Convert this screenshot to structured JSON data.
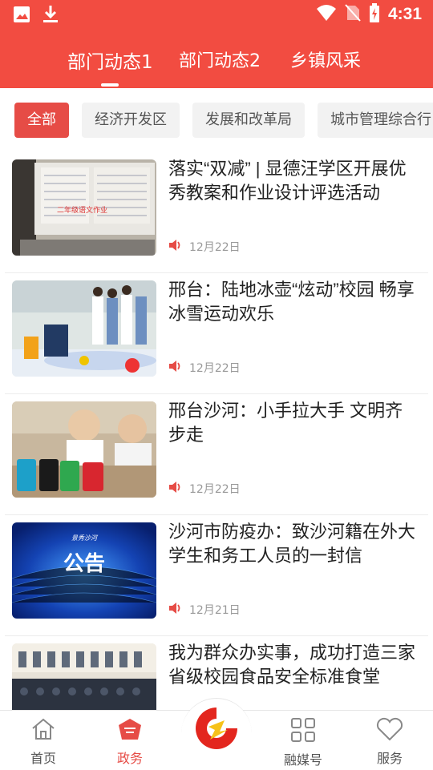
{
  "status_bar": {
    "time": "4:31",
    "left_icons": [
      "image-icon",
      "download-icon"
    ],
    "right_icons": [
      "wifi-icon",
      "no-sim-icon",
      "battery-charging-icon"
    ]
  },
  "top_tabs": [
    {
      "label": "部门动态1",
      "active": true
    },
    {
      "label": "部门动态2",
      "active": false
    },
    {
      "label": "乡镇风采",
      "active": false
    }
  ],
  "filter_chips": [
    {
      "label": "全部",
      "active": true
    },
    {
      "label": "经济开发区",
      "active": false
    },
    {
      "label": "发展和改革局",
      "active": false
    },
    {
      "label": "城市管理综合行",
      "active": false
    }
  ],
  "articles": [
    {
      "title": "落实“双减” | 显德汪学区开展优秀教案和作业设计评选活动",
      "date": "12月22日",
      "thumb_caption": "二年级语文作业"
    },
    {
      "title": "邢台：陆地冰壶“炫动”校园 畅享冰雪运动欢乐",
      "date": "12月22日"
    },
    {
      "title": "邢台沙河：小手拉大手 文明齐步走",
      "date": "12月22日"
    },
    {
      "title": "沙河市防疫办：致沙河籍在外大学生和务工人员的一封信",
      "date": "12月21日",
      "thumb_caption": "公告",
      "thumb_top": "景秀沙河"
    },
    {
      "title": "我为群众办实事，成功打造三家省级校园食品安全标准食堂",
      "date": ""
    }
  ],
  "bottom_nav": [
    {
      "label": "首页",
      "icon": "home-icon",
      "active": false
    },
    {
      "label": "政务",
      "icon": "government-icon",
      "active": true
    },
    {
      "label": "",
      "icon": "app-logo-icon",
      "active": false
    },
    {
      "label": "融媒号",
      "icon": "grid-icon",
      "active": false
    },
    {
      "label": "服务",
      "icon": "heart-icon",
      "active": false
    }
  ],
  "colors": {
    "brand_red": "#f24c41",
    "chip_active": "#e64c46",
    "text": "#222222",
    "meta": "#999999"
  }
}
